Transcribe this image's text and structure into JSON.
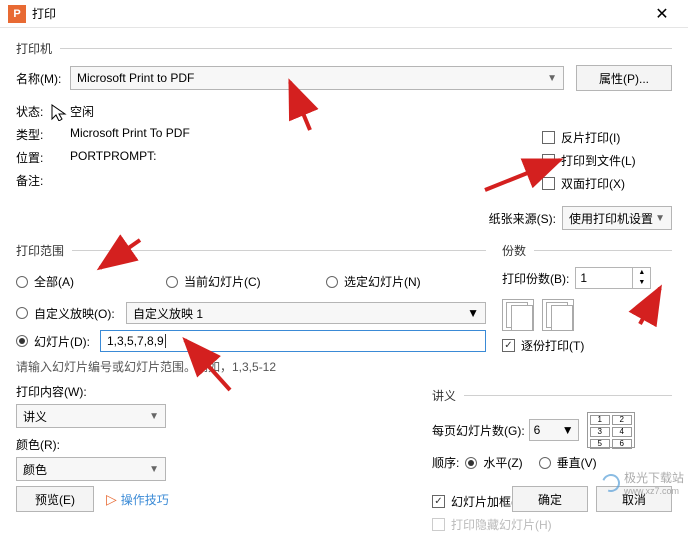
{
  "window": {
    "title": "打印",
    "close": "✕"
  },
  "printer": {
    "group": "打印机",
    "name_label": "名称(M):",
    "name_value": "Microsoft Print to PDF",
    "props_btn": "属性(P)...",
    "status_label": "状态:",
    "status_value": "空闲",
    "type_label": "类型:",
    "type_value": "Microsoft Print To PDF",
    "where_label": "位置:",
    "where_value": "PORTPROMPT:",
    "comment_label": "备注:",
    "comment_value": "",
    "reverse": "反片打印(I)",
    "tofile": "打印到文件(L)",
    "duplex": "双面打印(X)",
    "paper_label": "纸张来源(S):",
    "paper_value": "使用打印机设置"
  },
  "range": {
    "group": "打印范围",
    "all": "全部(A)",
    "current": "当前幻灯片(C)",
    "selected": "选定幻灯片(N)",
    "custom": "自定义放映(O):",
    "custom_value": "自定义放映 1",
    "slides": "幻灯片(D):",
    "slides_value": "1,3,5,7,8,9",
    "hint": "请输入幻灯片编号或幻灯片范围。例如，1,3,5-12"
  },
  "copies": {
    "group": "份数",
    "count_label": "打印份数(B):",
    "count_value": "1",
    "collate": "逐份打印(T)"
  },
  "content": {
    "label": "打印内容(W):",
    "value": "讲义",
    "color_label": "颜色(R):",
    "color_value": "颜色"
  },
  "handout": {
    "group": "讲义",
    "perpage_label": "每页幻灯片数(G):",
    "perpage_value": "6",
    "order_label": "顺序:",
    "horiz": "水平(Z)",
    "vert": "垂直(V)",
    "cells": [
      "1",
      "2",
      "3",
      "4",
      "5",
      "6"
    ]
  },
  "extras": {
    "frame": "幻灯片加框(F)",
    "hidden": "打印隐藏幻灯片(H)"
  },
  "footer": {
    "preview": "预览(E)",
    "tips": "操作技巧",
    "ok": "确定",
    "cancel": "取消"
  },
  "watermark": "极光下载站",
  "watermark_url": "www.xz7.com"
}
